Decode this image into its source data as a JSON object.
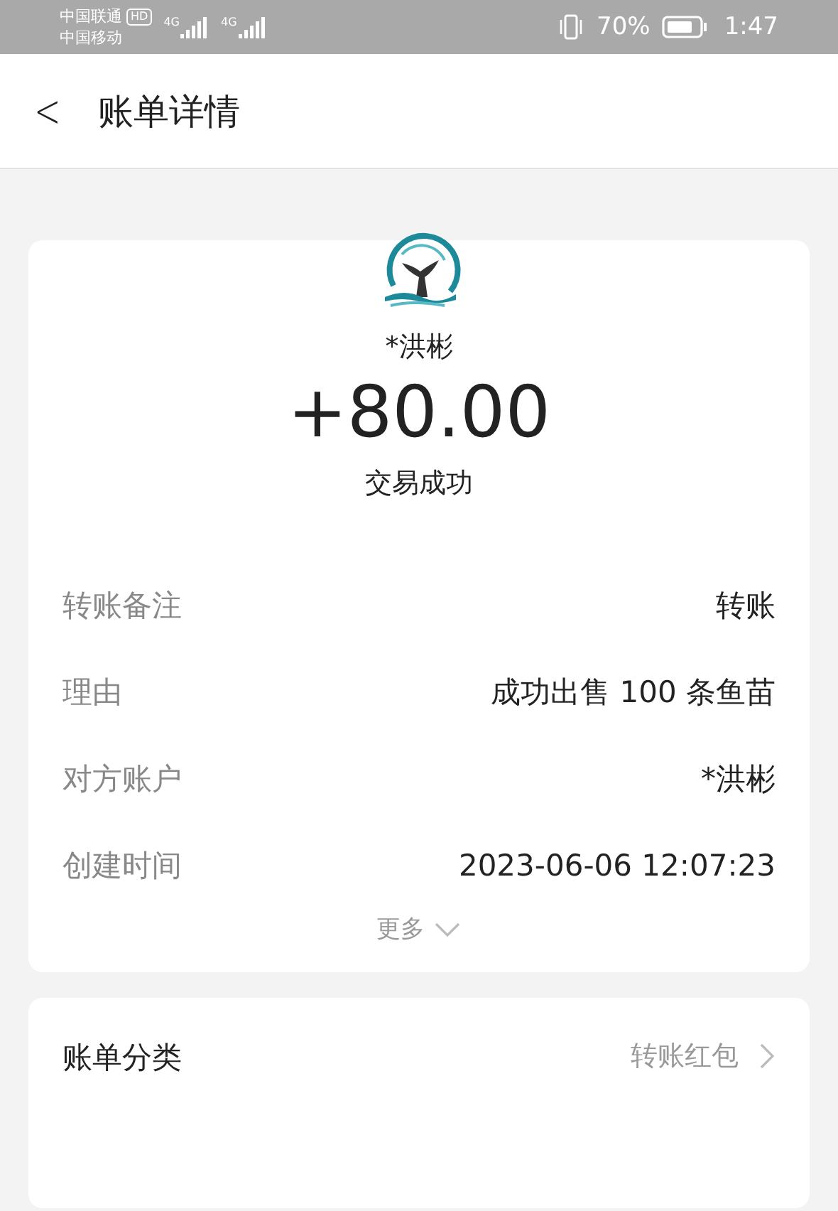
{
  "status_bar": {
    "carriers": [
      "中国联通",
      "中国移动"
    ],
    "hd_badge": "HD",
    "network_labels": [
      "4G",
      "4G"
    ],
    "battery": "70%",
    "time": "1:47"
  },
  "header": {
    "back": "<",
    "title": "账单详情"
  },
  "transaction": {
    "name": "*洪彬",
    "amount": "+80.00",
    "status": "交易成功",
    "rows": [
      {
        "label": "转账备注",
        "value": "转账"
      },
      {
        "label": "理由",
        "value": "成功出售 100 条鱼苗"
      },
      {
        "label": "对方账户",
        "value": "*洪彬"
      },
      {
        "label": "创建时间",
        "value": "2023-06-06 12:07:23"
      }
    ],
    "more": "更多"
  },
  "category": {
    "label": "账单分类",
    "value": "转账红包"
  }
}
